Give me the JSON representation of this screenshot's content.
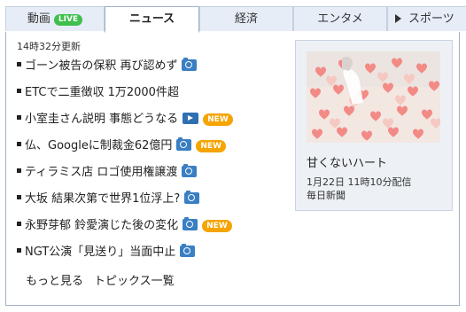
{
  "tabs": [
    {
      "label": "動画",
      "badge": "LIVE"
    },
    {
      "label": "ニュース"
    },
    {
      "label": "経済"
    },
    {
      "label": "エンタメ"
    },
    {
      "label": "スポーツ"
    }
  ],
  "updated": "14時32分更新",
  "news": [
    {
      "title": "ゴーン被告の保釈 再び認めず",
      "icon": "camera-icon"
    },
    {
      "title": "ETCで二重徴収 1万2000件超"
    },
    {
      "title": "小室圭さん説明 事態どうなる",
      "icon": "video-icon",
      "badge": "NEW"
    },
    {
      "title": "仏、Googleに制裁金62億円",
      "icon": "camera-icon",
      "badge": "NEW"
    },
    {
      "title": "ティラミス店 ロゴ使用権譲渡",
      "icon": "camera-icon"
    },
    {
      "title": "大坂 結果次第で世界1位浮上?",
      "icon": "camera-icon"
    },
    {
      "title": "永野芽郁 鈴愛演じた後の変化",
      "icon": "camera-icon",
      "badge": "NEW"
    },
    {
      "title": "NGT公演「見送り」当面中止",
      "icon": "camera-icon"
    }
  ],
  "footer": {
    "more": "もっと見る",
    "topics": "トピックス一覧"
  },
  "pickup": {
    "title": "甘くないハート",
    "date": "1月22日 11時10分配信",
    "source": "毎日新聞"
  },
  "colors": {
    "accent_blue": "#3a7fc3",
    "live_green": "#3fbf4c",
    "new_orange": "#f5a400",
    "tab_bg": "#e6edf7"
  }
}
